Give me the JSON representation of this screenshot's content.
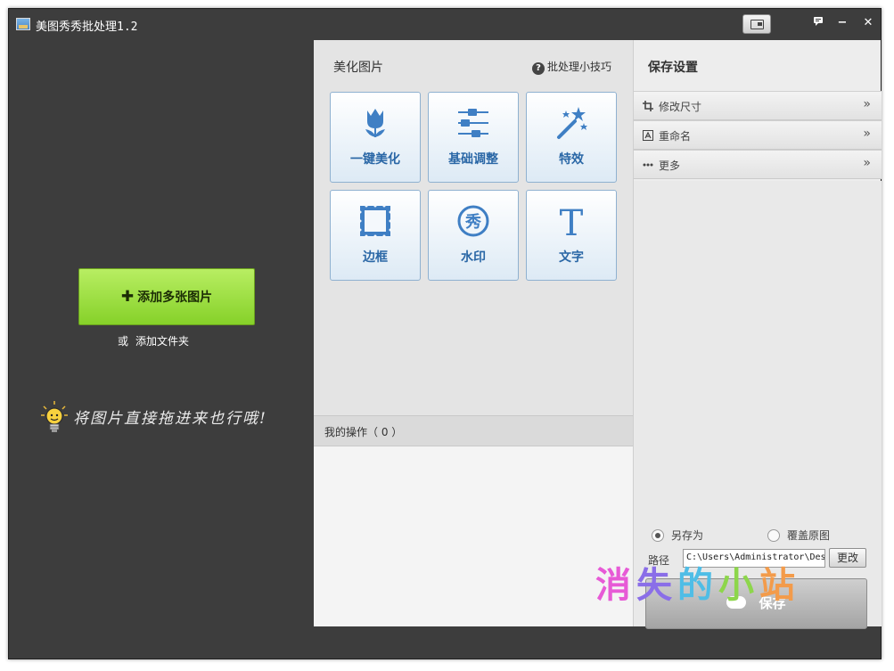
{
  "window": {
    "title": "美图秀秀批处理1.2",
    "controls": {
      "mini_icon": "mini-mode-icon",
      "feedback_icon": "chat-icon",
      "minimize": "−",
      "close": "✕"
    }
  },
  "left": {
    "add_button": "添加多张图片",
    "or_text": "或",
    "add_folder": "添加文件夹",
    "drag_hint": "将图片直接拖进来也行哦!"
  },
  "middle": {
    "header": "美化图片",
    "tips": "批处理小技巧",
    "tiles": [
      {
        "label": "一键美化",
        "icon": "tulip-icon"
      },
      {
        "label": "基础调整",
        "icon": "sliders-icon"
      },
      {
        "label": "特效",
        "icon": "magic-wand-icon"
      },
      {
        "label": "边框",
        "icon": "frame-icon"
      },
      {
        "label": "水印",
        "icon": "watermark-icon"
      },
      {
        "label": "文字",
        "icon": "text-icon"
      }
    ],
    "watermark_glyph": "秀",
    "text_glyph": "T",
    "ops_label": "我的操作（ 0 ）"
  },
  "right": {
    "title": "保存设置",
    "rows": [
      {
        "label": "修改尺寸",
        "icon": "crop-icon"
      },
      {
        "label": "重命名",
        "icon": "rename-icon"
      },
      {
        "label": "更多",
        "icon": "more-icon"
      }
    ],
    "chevron": "»",
    "save_as": "另存为",
    "overwrite": "覆盖原图",
    "path_label": "路径",
    "path_value": "C:\\Users\\Administrator\\Desktop",
    "change_button": "更改",
    "save_button": "保存"
  },
  "overlay_watermark": "消失的小站",
  "colors": {
    "accent_green": "#86d129",
    "tile_blue": "#2a67a6",
    "dark_bg": "#3d3d3d"
  }
}
